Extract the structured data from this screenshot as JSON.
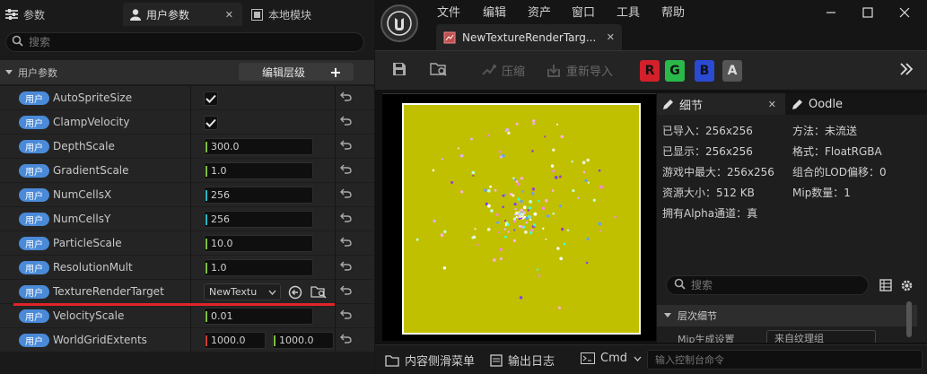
{
  "left_panel": {
    "tabs": [
      {
        "label": "参数",
        "icon": "sliders-icon"
      },
      {
        "label": "用户参数",
        "icon": "user-icon"
      },
      {
        "label": "本地模块",
        "icon": "module-icon"
      }
    ],
    "search_placeholder": "搜索",
    "category": {
      "label": "用户参数",
      "edit_button": "编辑层级",
      "add_button": "+"
    },
    "badge_label": "用户",
    "params": [
      {
        "name": "AutoSpriteSize",
        "type": "bool",
        "checked": true
      },
      {
        "name": "ClampVelocity",
        "type": "bool",
        "checked": true
      },
      {
        "name": "DepthScale",
        "type": "float",
        "value": "300.0"
      },
      {
        "name": "GradientScale",
        "type": "float",
        "value": "1.0"
      },
      {
        "name": "NumCellsX",
        "type": "int",
        "value": "256"
      },
      {
        "name": "NumCellsY",
        "type": "int",
        "value": "256"
      },
      {
        "name": "ParticleScale",
        "type": "float",
        "value": "10.0"
      },
      {
        "name": "ResolutionMult",
        "type": "float",
        "value": "1.0"
      },
      {
        "name": "TextureRenderTarget",
        "type": "asset",
        "value": "NewTextu"
      },
      {
        "name": "VelocityScale",
        "type": "float",
        "value": "0.01"
      },
      {
        "name": "WorldGridExtents",
        "type": "vec2",
        "x": "1000.0",
        "y": "1000.0"
      }
    ]
  },
  "editor": {
    "menu": [
      "文件",
      "编辑",
      "资产",
      "窗口",
      "工具",
      "帮助"
    ],
    "doc_tab": "NewTextureRenderTarg...",
    "toolbar": {
      "compress": "压缩",
      "reimport": "重新导入",
      "channels": [
        "R",
        "G",
        "B",
        "A"
      ]
    },
    "details_tab": "细节",
    "oodle_tab": "Oodle",
    "info_left": [
      "已导入：256x256",
      "已显示：256x256",
      "游戏中最大：256x256",
      "资源大小：512 KB",
      "拥有Alpha通道：真"
    ],
    "info_right": [
      "方法：未流送",
      "格式：FloatRGBA",
      "组合的LOD偏移：0",
      "Mip数量：1"
    ],
    "details_search_placeholder": "搜索",
    "lod_section": "层次细节",
    "mip_label": "Mip生成设置",
    "mip_value": "来自纹理组",
    "bottom": {
      "content_drawer": "内容侧滑菜单",
      "output_log": "输出日志",
      "cmd": "Cmd",
      "console_placeholder": "输入控制台命令"
    }
  },
  "colors": {
    "badge": "#4a8ad8",
    "texture_bg": "#c0c000",
    "highlight_line": "#e0242a",
    "channel_r": "#d4202a",
    "channel_g": "#2ab84a",
    "channel_b": "#2a4ad4",
    "channel_a": "#555555"
  }
}
